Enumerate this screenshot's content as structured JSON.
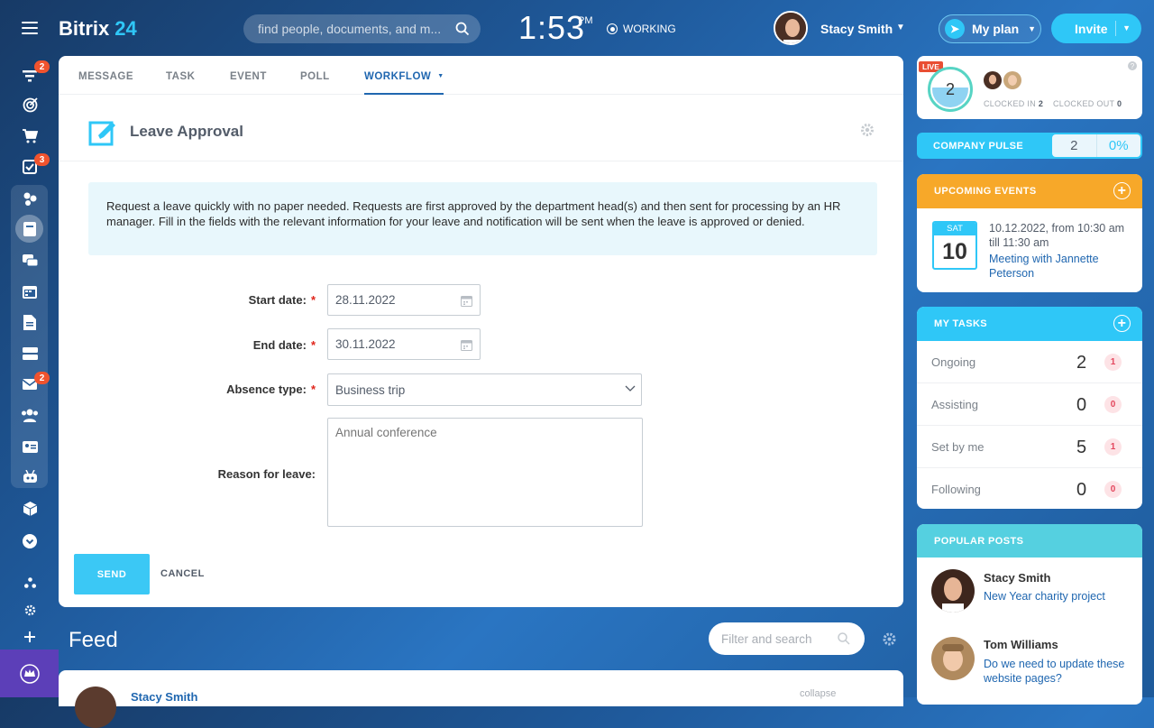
{
  "app": {
    "name": "Bitrix",
    "name_num": "24"
  },
  "search": {
    "placeholder": "find people, documents, and m..."
  },
  "clock": {
    "time": "1:53",
    "ampm": "PM",
    "status": "WORKING"
  },
  "user": {
    "name": "Stacy Smith"
  },
  "header": {
    "my_plan": "My plan",
    "invite": "Invite"
  },
  "sidebar": {
    "items": [
      {
        "icon": "filter-icon",
        "badge": "2"
      },
      {
        "icon": "target-icon"
      },
      {
        "icon": "cart-icon"
      },
      {
        "icon": "tasks-icon",
        "badge": "3"
      },
      {
        "icon": "sites-icon"
      },
      {
        "icon": "feed-icon"
      },
      {
        "icon": "chat-icon"
      },
      {
        "icon": "calendar-icon"
      },
      {
        "icon": "documents-icon"
      },
      {
        "icon": "drive-icon"
      },
      {
        "icon": "mail-icon",
        "badge": "2"
      },
      {
        "icon": "employees-icon"
      },
      {
        "icon": "contact-icon"
      },
      {
        "icon": "robot-icon"
      },
      {
        "icon": "box-icon"
      },
      {
        "icon": "more-icon"
      },
      {
        "icon": "structure-icon"
      },
      {
        "icon": "settings-icon"
      },
      {
        "icon": "add-icon"
      }
    ]
  },
  "tabs": [
    "MESSAGE",
    "TASK",
    "EVENT",
    "POLL",
    "WORKFLOW"
  ],
  "form": {
    "title": "Leave Approval",
    "info": "Request a leave quickly with no paper needed. Requests are first approved by the department head(s) and then sent for processing by an HR manager. Fill in the fields with the relevant information for your leave and notification will be sent when the leave is approved or denied.",
    "start_label": "Start date:",
    "start_value": "28.11.2022",
    "end_label": "End date:",
    "end_value": "30.11.2022",
    "absence_label": "Absence type:",
    "absence_value": "Business trip",
    "reason_label": "Reason for leave:",
    "reason_placeholder": "Annual conference",
    "required_mark": "*",
    "send": "SEND",
    "cancel": "CANCEL"
  },
  "feed": {
    "title": "Feed",
    "filter_placeholder": "Filter and search",
    "first_author": "Stacy Smith",
    "collapse": "collapse"
  },
  "timeman": {
    "live": "LIVE",
    "count": "2",
    "clocked_in_label": "CLOCKED IN",
    "clocked_in": "2",
    "clocked_out_label": "CLOCKED OUT",
    "clocked_out": "0"
  },
  "pulse": {
    "label": "COMPANY PULSE",
    "value": "2",
    "percent": "0%"
  },
  "events": {
    "title": "UPCOMING EVENTS",
    "day": "SAT",
    "date": "10",
    "time": "10.12.2022, from 10:30 am till 11:30 am",
    "name": "Meeting with Jannette Peterson"
  },
  "tasks": {
    "title": "MY TASKS",
    "rows": [
      {
        "label": "Ongoing",
        "value": "2",
        "badge": "1"
      },
      {
        "label": "Assisting",
        "value": "0",
        "badge": "0"
      },
      {
        "label": "Set by me",
        "value": "5",
        "badge": "1"
      },
      {
        "label": "Following",
        "value": "0",
        "badge": "0"
      }
    ]
  },
  "posts": {
    "title": "POPULAR POSTS",
    "items": [
      {
        "author": "Stacy Smith",
        "title": "New Year charity project"
      },
      {
        "author": "Tom Williams",
        "title": "Do we need to update these website pages?"
      }
    ]
  },
  "colors": {
    "accent": "#2fc7f7",
    "events": "#f7a829",
    "posts": "#55d0e0",
    "badge": "#f0532e",
    "crown": "#5c3fb8"
  }
}
